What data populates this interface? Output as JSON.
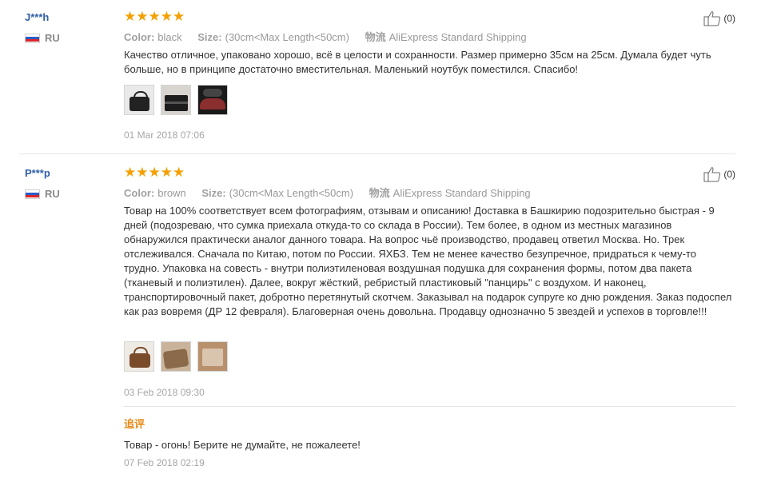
{
  "reviews": [
    {
      "username": "J***h",
      "country": "RU",
      "rating": 5,
      "color_label": "Color:",
      "color_value": "black",
      "size_label": "Size:",
      "size_value": "(30cm<Max Length<50cm)",
      "shipping_label": "物流",
      "shipping_value": "AliExpress Standard Shipping",
      "text": "Качество отличное, упаковано хорошо, всё в целости и сохранности. Размер примерно 35см на 25см. Думала будет чуть больше, но в принципе достаточно вместительная. Маленький ноутбук поместился. Спасибо!",
      "photo_count": 3,
      "date": "01 Mar 2018 07:06",
      "helpful": "(0)"
    },
    {
      "username": "P***p",
      "country": "RU",
      "rating": 5,
      "color_label": "Color:",
      "color_value": "brown",
      "size_label": "Size:",
      "size_value": "(30cm<Max Length<50cm)",
      "shipping_label": "物流",
      "shipping_value": "AliExpress Standard Shipping",
      "text": "Товар на 100% соответствует всем фотографиям, отзывам и описанию! Доставка в Башкирию подозрительно быстрая - 9 дней (подозреваю, что сумка приехала откуда-то со склада в России). Тем более, в одном из местных магазинов обнаружился практически аналог данного товара. На вопрос чьё производство, продавец ответил Москва. Но. Трек отслеживался. Сначала по Китаю, потом по России. ЯХБЗ. Тем не менее качество безупречное, придраться к чему-то трудно. Упаковка на совесть - внутри полиэтиленовая воздушная подушка для сохранения формы, потом два пакета (тканевый и полиэтилен). Далее, вокруг жёсткий, ребристый пластиковый \"панцирь\" с воздухом. И наконец, транспортировочный пакет, добротно перетянутый скотчем. Заказывал на подарок супруге ко дню рождения. Заказ подоспел как раз вовремя (ДР 12 февраля). Благоверная очень довольна. Продавцу однозначно 5 звездей и успехов в торговле!!!",
      "photo_count": 3,
      "date": "03 Feb 2018 09:30",
      "helpful": "(0)",
      "followup_label": "追评",
      "followup_text": "Товар - огонь! Берите не думайте, не пожалеете!",
      "followup_date": "07 Feb 2018 02:19"
    }
  ],
  "colors": {
    "star": "#f5a000",
    "username": "#2f5fa8",
    "followup": "#e88a1a"
  },
  "icons": [
    "thumbs-up-icon",
    "star-icon",
    "ru-flag-icon"
  ]
}
